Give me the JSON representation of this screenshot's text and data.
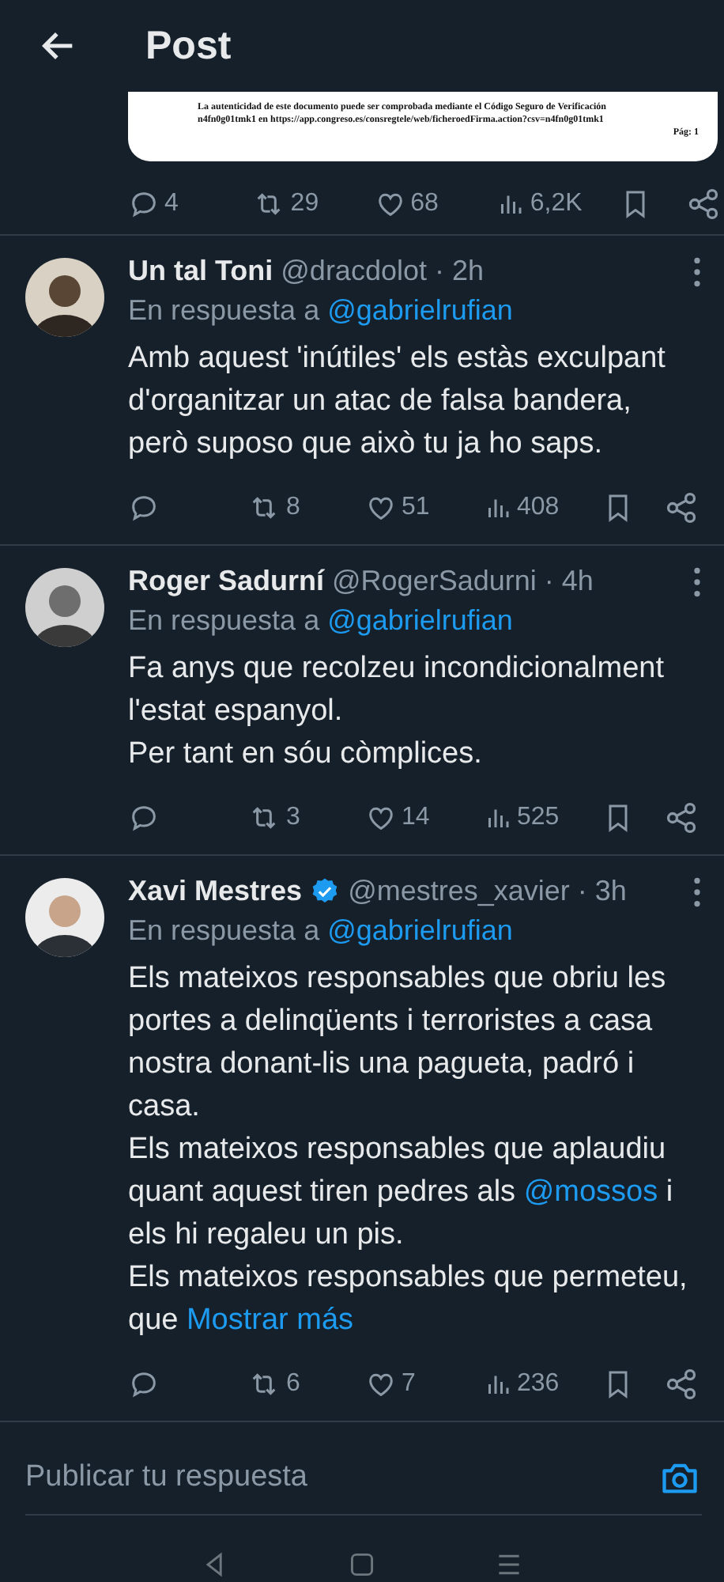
{
  "header": {
    "title": "Post"
  },
  "quoted_document": {
    "lines": [
      "La autenticidad de este documento puede ser comprobada mediante el Código Seguro de Verificación",
      "n4fn0g01tmk1 en https://app.congreso.es/consregtele/web/ficheroedFirma.action?csv=n4fn0g01tmk1",
      "Pág: 1"
    ]
  },
  "main_stats": {
    "replies": "4",
    "retweets": "29",
    "likes": "68",
    "views": "6,2K"
  },
  "replies": [
    {
      "name": "Un tal Toni",
      "verified": false,
      "handle": "@dracdolot",
      "time": "· 2h",
      "reply_label": "En respuesta a",
      "reply_to": "@gabrielrufian",
      "paragraphs": [
        [
          {
            "kind": "text",
            "text": "Amb aquest 'inútiles' els estàs exculpant d'organitzar un atac de falsa bandera, però suposo que això tu ja ho saps."
          }
        ]
      ],
      "stats": {
        "retweets": "8",
        "likes": "51",
        "views": "408"
      }
    },
    {
      "name": "Roger Sadurní",
      "verified": false,
      "handle": "@RogerSadurni",
      "time": "· 4h",
      "reply_label": "En respuesta a",
      "reply_to": "@gabrielrufian",
      "paragraphs": [
        [
          {
            "kind": "text",
            "text": "Fa anys que recolzeu incondicionalment l'estat espanyol."
          }
        ],
        [
          {
            "kind": "text",
            "text": "Per tant en sóu còmplices."
          }
        ]
      ],
      "stats": {
        "retweets": "3",
        "likes": "14",
        "views": "525"
      }
    },
    {
      "name": "Xavi Mestres",
      "verified": true,
      "handle": "@mestres_xavier",
      "time": "· 3h",
      "reply_label": "En respuesta a",
      "reply_to": "@gabrielrufian",
      "paragraphs": [
        [
          {
            "kind": "text",
            "text": "Els mateixos responsables que obriu les portes a delinqüents i terroristes a casa nostra donant-lis una pagueta, padró i casa."
          }
        ],
        [
          {
            "kind": "text",
            "text": "Els mateixos responsables que aplaudiu quant aquest tiren pedres als "
          },
          {
            "kind": "mention",
            "text": "@mossos"
          },
          {
            "kind": "text",
            "text": " i els hi regaleu un pis."
          }
        ],
        [
          {
            "kind": "text",
            "text": "Els mateixos responsables que permeteu, que "
          },
          {
            "kind": "more",
            "text": "Mostrar más"
          }
        ]
      ],
      "stats": {
        "retweets": "6",
        "likes": "7",
        "views": "236"
      }
    }
  ],
  "composer": {
    "placeholder": "Publicar tu respuesta"
  }
}
